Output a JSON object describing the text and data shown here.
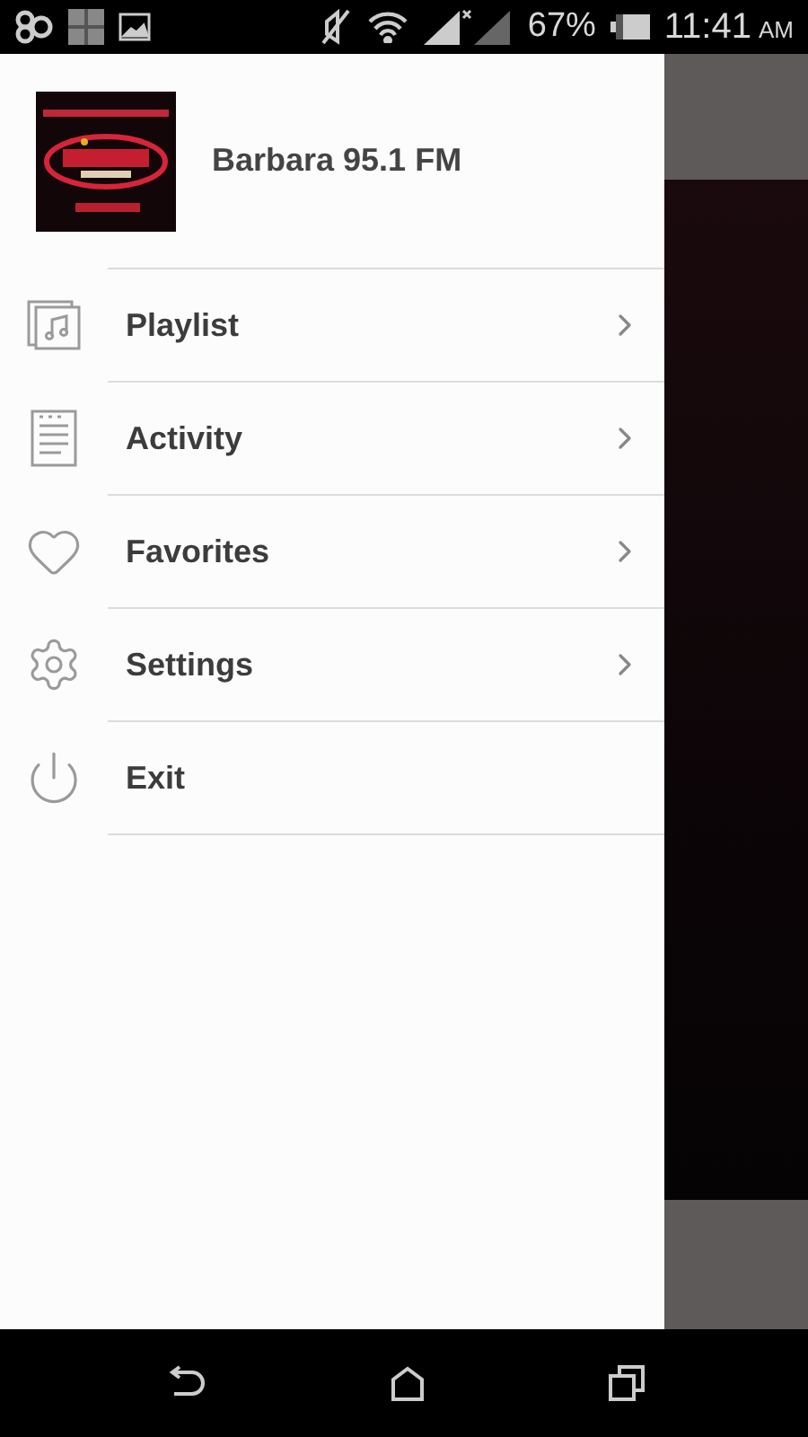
{
  "status_bar": {
    "battery": "67%",
    "time": "11:41",
    "meridiem": "AM"
  },
  "drawer": {
    "station": "Barbara 95.1 FM",
    "items": [
      {
        "kind": "playlist",
        "label": "Playlist",
        "chevron": true
      },
      {
        "kind": "activity",
        "label": "Activity",
        "chevron": true
      },
      {
        "kind": "favorites",
        "label": "Favorites",
        "chevron": true
      },
      {
        "kind": "settings",
        "label": "Settings",
        "chevron": true
      },
      {
        "kind": "exit",
        "label": "Exit",
        "chevron": false
      }
    ]
  }
}
